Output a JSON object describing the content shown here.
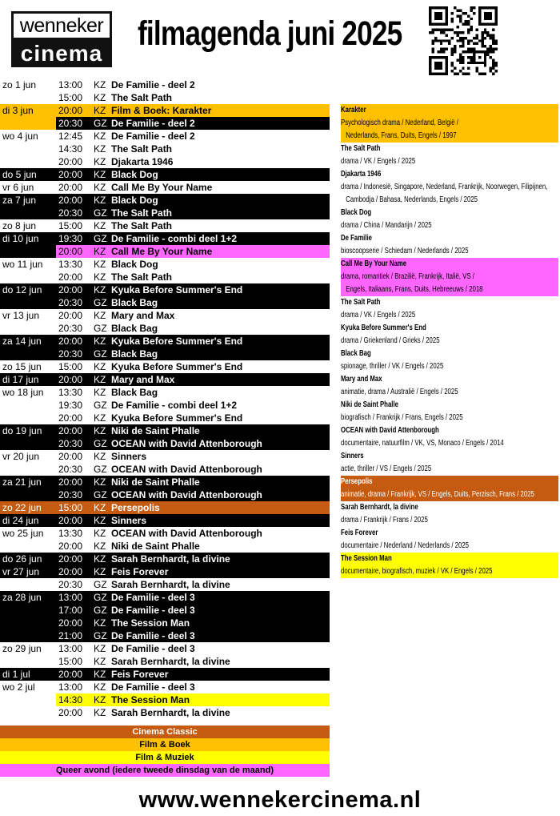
{
  "header": {
    "logo_line1": "wenneker",
    "logo_line2": "cinema",
    "title": "filmagenda juni 2025"
  },
  "colors": {
    "black": "#000000",
    "film_boek": "#FFC000",
    "queer": "#FF66FF",
    "film_muziek": "#FFFF00",
    "cinema_classic": "#C55A11"
  },
  "schedule": [
    {
      "date": "zo 1 jun",
      "time": "13:00",
      "hall": "KZ",
      "film": "De Familie - deel 2",
      "style": ""
    },
    {
      "date": "",
      "time": "15:00",
      "hall": "KZ",
      "film": "The Salt Path",
      "style": ""
    },
    {
      "date": "di 3 jun",
      "time": "20:00",
      "hall": "KZ",
      "film": "Film & Boek: Karakter",
      "style": "orange"
    },
    {
      "date": "",
      "time": "20:30",
      "hall": "GZ",
      "film": "De Familie - deel 2",
      "style": "black",
      "date_style": "dp-orange"
    },
    {
      "date": "wo 4 jun",
      "time": "12:45",
      "hall": "KZ",
      "film": "De Familie - deel 2",
      "style": ""
    },
    {
      "date": "",
      "time": "14:30",
      "hall": "KZ",
      "film": "The Salt Path",
      "style": ""
    },
    {
      "date": "",
      "time": "20:00",
      "hall": "KZ",
      "film": "Djakarta 1946",
      "style": ""
    },
    {
      "date": "do 5 jun",
      "time": "20:00",
      "hall": "KZ",
      "film": "Black Dog",
      "style": "black"
    },
    {
      "date": "vr 6 jun",
      "time": "20:00",
      "hall": "KZ",
      "film": "Call Me By Your Name",
      "style": ""
    },
    {
      "date": "za 7 jun",
      "time": "20:00",
      "hall": "KZ",
      "film": "Black Dog",
      "style": "black"
    },
    {
      "date": "",
      "time": "20:30",
      "hall": "GZ",
      "film": "The Salt Path",
      "style": "black"
    },
    {
      "date": "zo 8 jun",
      "time": "15:00",
      "hall": "KZ",
      "film": "The Salt Path",
      "style": ""
    },
    {
      "date": "di 10 jun",
      "time": "19:30",
      "hall": "GZ",
      "film": "De Familie - combi deel 1+2",
      "style": "black"
    },
    {
      "date": "",
      "time": "20:00",
      "hall": "KZ",
      "film": "Call Me By Your Name",
      "style": "pink",
      "date_style": "black"
    },
    {
      "date": "wo 11 jun",
      "time": "13:30",
      "hall": "KZ",
      "film": "Black Dog",
      "style": ""
    },
    {
      "date": "",
      "time": "20:00",
      "hall": "KZ",
      "film": "The Salt Path",
      "style": ""
    },
    {
      "date": "do 12 jun",
      "time": "20:00",
      "hall": "KZ",
      "film": "Kyuka Before Summer's End",
      "style": "black"
    },
    {
      "date": "",
      "time": "20:30",
      "hall": "GZ",
      "film": "Black Bag",
      "style": "black"
    },
    {
      "date": "vr 13 jun",
      "time": "20:00",
      "hall": "KZ",
      "film": "Mary and Max",
      "style": ""
    },
    {
      "date": "",
      "time": "20:30",
      "hall": "GZ",
      "film": "Black Bag",
      "style": ""
    },
    {
      "date": "za 14 jun",
      "time": "20:00",
      "hall": "KZ",
      "film": "Kyuka Before Summer's End",
      "style": "black"
    },
    {
      "date": "",
      "time": "20:30",
      "hall": "GZ",
      "film": "Black Bag",
      "style": "black"
    },
    {
      "date": "zo 15 jun",
      "time": "15:00",
      "hall": "KZ",
      "film": "Kyuka Before Summer's End",
      "style": ""
    },
    {
      "date": "di 17 jun",
      "time": "20:00",
      "hall": "KZ",
      "film": "Mary and Max",
      "style": "black"
    },
    {
      "date": "wo 18 jun",
      "time": "13:30",
      "hall": "KZ",
      "film": "Black Bag",
      "style": ""
    },
    {
      "date": "",
      "time": "19:30",
      "hall": "GZ",
      "film": "De Familie - combi deel 1+2",
      "style": ""
    },
    {
      "date": "",
      "time": "20:00",
      "hall": "KZ",
      "film": "Kyuka Before Summer's End",
      "style": ""
    },
    {
      "date": "do 19 jun",
      "time": "20:00",
      "hall": "KZ",
      "film": "Niki de Saint Phalle",
      "style": "black"
    },
    {
      "date": "",
      "time": "20:30",
      "hall": "GZ",
      "film": "OCEAN with David Attenborough",
      "style": "black"
    },
    {
      "date": "vr 20 jun",
      "time": "20:00",
      "hall": "KZ",
      "film": "Sinners",
      "style": ""
    },
    {
      "date": "",
      "time": "20:30",
      "hall": "GZ",
      "film": "OCEAN with David Attenborough",
      "style": ""
    },
    {
      "date": "za 21 jun",
      "time": "20:00",
      "hall": "KZ",
      "film": "Niki de Saint Phalle",
      "style": "black"
    },
    {
      "date": "",
      "time": "20:30",
      "hall": "GZ",
      "film": "OCEAN with David Attenborough",
      "style": "black"
    },
    {
      "date": "zo 22 jun",
      "time": "15:00",
      "hall": "KZ",
      "film": "Persepolis",
      "style": "rust"
    },
    {
      "date": "di 24 jun",
      "time": "20:00",
      "hall": "KZ",
      "film": "Sinners",
      "style": "black"
    },
    {
      "date": "wo 25 jun",
      "time": "13:30",
      "hall": "KZ",
      "film": "OCEAN with David Attenborough",
      "style": ""
    },
    {
      "date": "",
      "time": "20:00",
      "hall": "KZ",
      "film": "Niki de Saint Phalle",
      "style": ""
    },
    {
      "date": "do 26 jun",
      "time": "20:00",
      "hall": "KZ",
      "film": "Sarah Bernhardt, la divine",
      "style": "black"
    },
    {
      "date": "vr 27 jun",
      "time": "20:00",
      "hall": "KZ",
      "film": "Feis Forever",
      "style": "black"
    },
    {
      "date": "",
      "time": "20:30",
      "hall": "GZ",
      "film": "Sarah Bernhardt, la divine",
      "style": ""
    },
    {
      "date": "za 28 jun",
      "time": "13:00",
      "hall": "GZ",
      "film": "De Familie - deel 3",
      "style": "black"
    },
    {
      "date": "",
      "time": "17:00",
      "hall": "GZ",
      "film": "De Familie - deel 3",
      "style": "black"
    },
    {
      "date": "",
      "time": "20:00",
      "hall": "KZ",
      "film": "The Session Man",
      "style": "black"
    },
    {
      "date": "",
      "time": "21:00",
      "hall": "GZ",
      "film": "De Familie - deel 3",
      "style": "black"
    },
    {
      "date": "zo 29 jun",
      "time": "13:00",
      "hall": "KZ",
      "film": "De Familie - deel 3",
      "style": ""
    },
    {
      "date": "",
      "time": "15:00",
      "hall": "KZ",
      "film": "Sarah Bernhardt, la divine",
      "style": ""
    },
    {
      "date": "di 1 jul",
      "time": "20:00",
      "hall": "KZ",
      "film": "Feis Forever",
      "style": "black"
    },
    {
      "date": "wo 2 jul",
      "time": "13:00",
      "hall": "KZ",
      "film": "De Familie - deel 3",
      "style": ""
    },
    {
      "date": "",
      "time": "14:30",
      "hall": "KZ",
      "film": "The Session Man",
      "style": "yellow",
      "date_style": "white"
    },
    {
      "date": "",
      "time": "20:00",
      "hall": "KZ",
      "film": "Sarah Bernhardt, la divine",
      "style": ""
    }
  ],
  "legend": [
    {
      "label": "Cinema Classic",
      "style": "rust"
    },
    {
      "label": "Film & Boek",
      "style": "orange"
    },
    {
      "label": "Film & Muziek",
      "style": "yellow"
    },
    {
      "label": "Queer avond (iedere tweede dinsdag van de maand)",
      "style": "pink"
    }
  ],
  "descriptions": [
    {
      "title": "Karakter",
      "lines": [
        "Psychologisch drama / Nederland, België /",
        "Nederlands, Frans, Duits, Engels / 1997"
      ],
      "style": "orange"
    },
    {
      "title": "The Salt Path",
      "lines": [
        "drama / VK / Engels / 2025"
      ],
      "style": ""
    },
    {
      "title": "Djakarta 1946",
      "lines": [
        "drama / Indonesië, Singapore, Nederland, Frankrijk, Noorwegen, Filipijnen,",
        "Cambodja / Bahasa, Nederlands, Engels / 2025"
      ],
      "style": ""
    },
    {
      "title": "Black Dog",
      "lines": [
        "drama / China / Mandarijn / 2025"
      ],
      "style": ""
    },
    {
      "title": "De Familie",
      "lines": [
        "bioscoopserie / Schiedam / Nederlands / 2025"
      ],
      "style": ""
    },
    {
      "title": "Call Me By Your Name",
      "lines": [
        "drama, romantiek / Brazilië, Frankrijk, Italië, VS /",
        "Engels, Italiaans, Frans, Duits, Hebreeuws / 2018"
      ],
      "style": "pink"
    },
    {
      "title": "The Salt Path",
      "lines": [
        "drama / VK / Engels / 2025"
      ],
      "style": ""
    },
    {
      "title": "Kyuka Before Summer's End",
      "lines": [
        "drama / Griekenland / Grieks / 2025"
      ],
      "style": ""
    },
    {
      "title": "Black Bag",
      "lines": [
        "spionage, thriller / VK / Engels / 2025"
      ],
      "style": ""
    },
    {
      "title": "Mary and Max",
      "lines": [
        "animatie, drama / Australië / Engels / 2025"
      ],
      "style": ""
    },
    {
      "title": "Niki de Saint Phalle",
      "lines": [
        "biografisch / Frankrijk / Frans, Engels / 2025"
      ],
      "style": ""
    },
    {
      "title": "OCEAN with David Attenborough",
      "lines": [
        "documentaire, natuurfilm / VK, VS, Monaco / Engels / 2014"
      ],
      "style": ""
    },
    {
      "title": "Sinners",
      "lines": [
        "actie, thriller / VS / Engels / 2025"
      ],
      "style": ""
    },
    {
      "title": "Persepolis",
      "lines": [
        "animatie, drama / Frankrijk, VS / Engels, Duits, Perzisch, Frans / 2025"
      ],
      "style": "rust"
    },
    {
      "title": "Sarah Bernhardt, la divine",
      "lines": [
        "drama / Frankrijk / Frans / 2025"
      ],
      "style": ""
    },
    {
      "title": "Feis Forever",
      "lines": [
        "documentaire / Nederland / Nederlands / 2025"
      ],
      "style": ""
    },
    {
      "title": "The Session Man",
      "lines": [
        "documentaire, biografisch, muziek / VK / Engels / 2025"
      ],
      "style": "yellow"
    }
  ],
  "footer": {
    "website": "www.wennekercinema.nl"
  }
}
